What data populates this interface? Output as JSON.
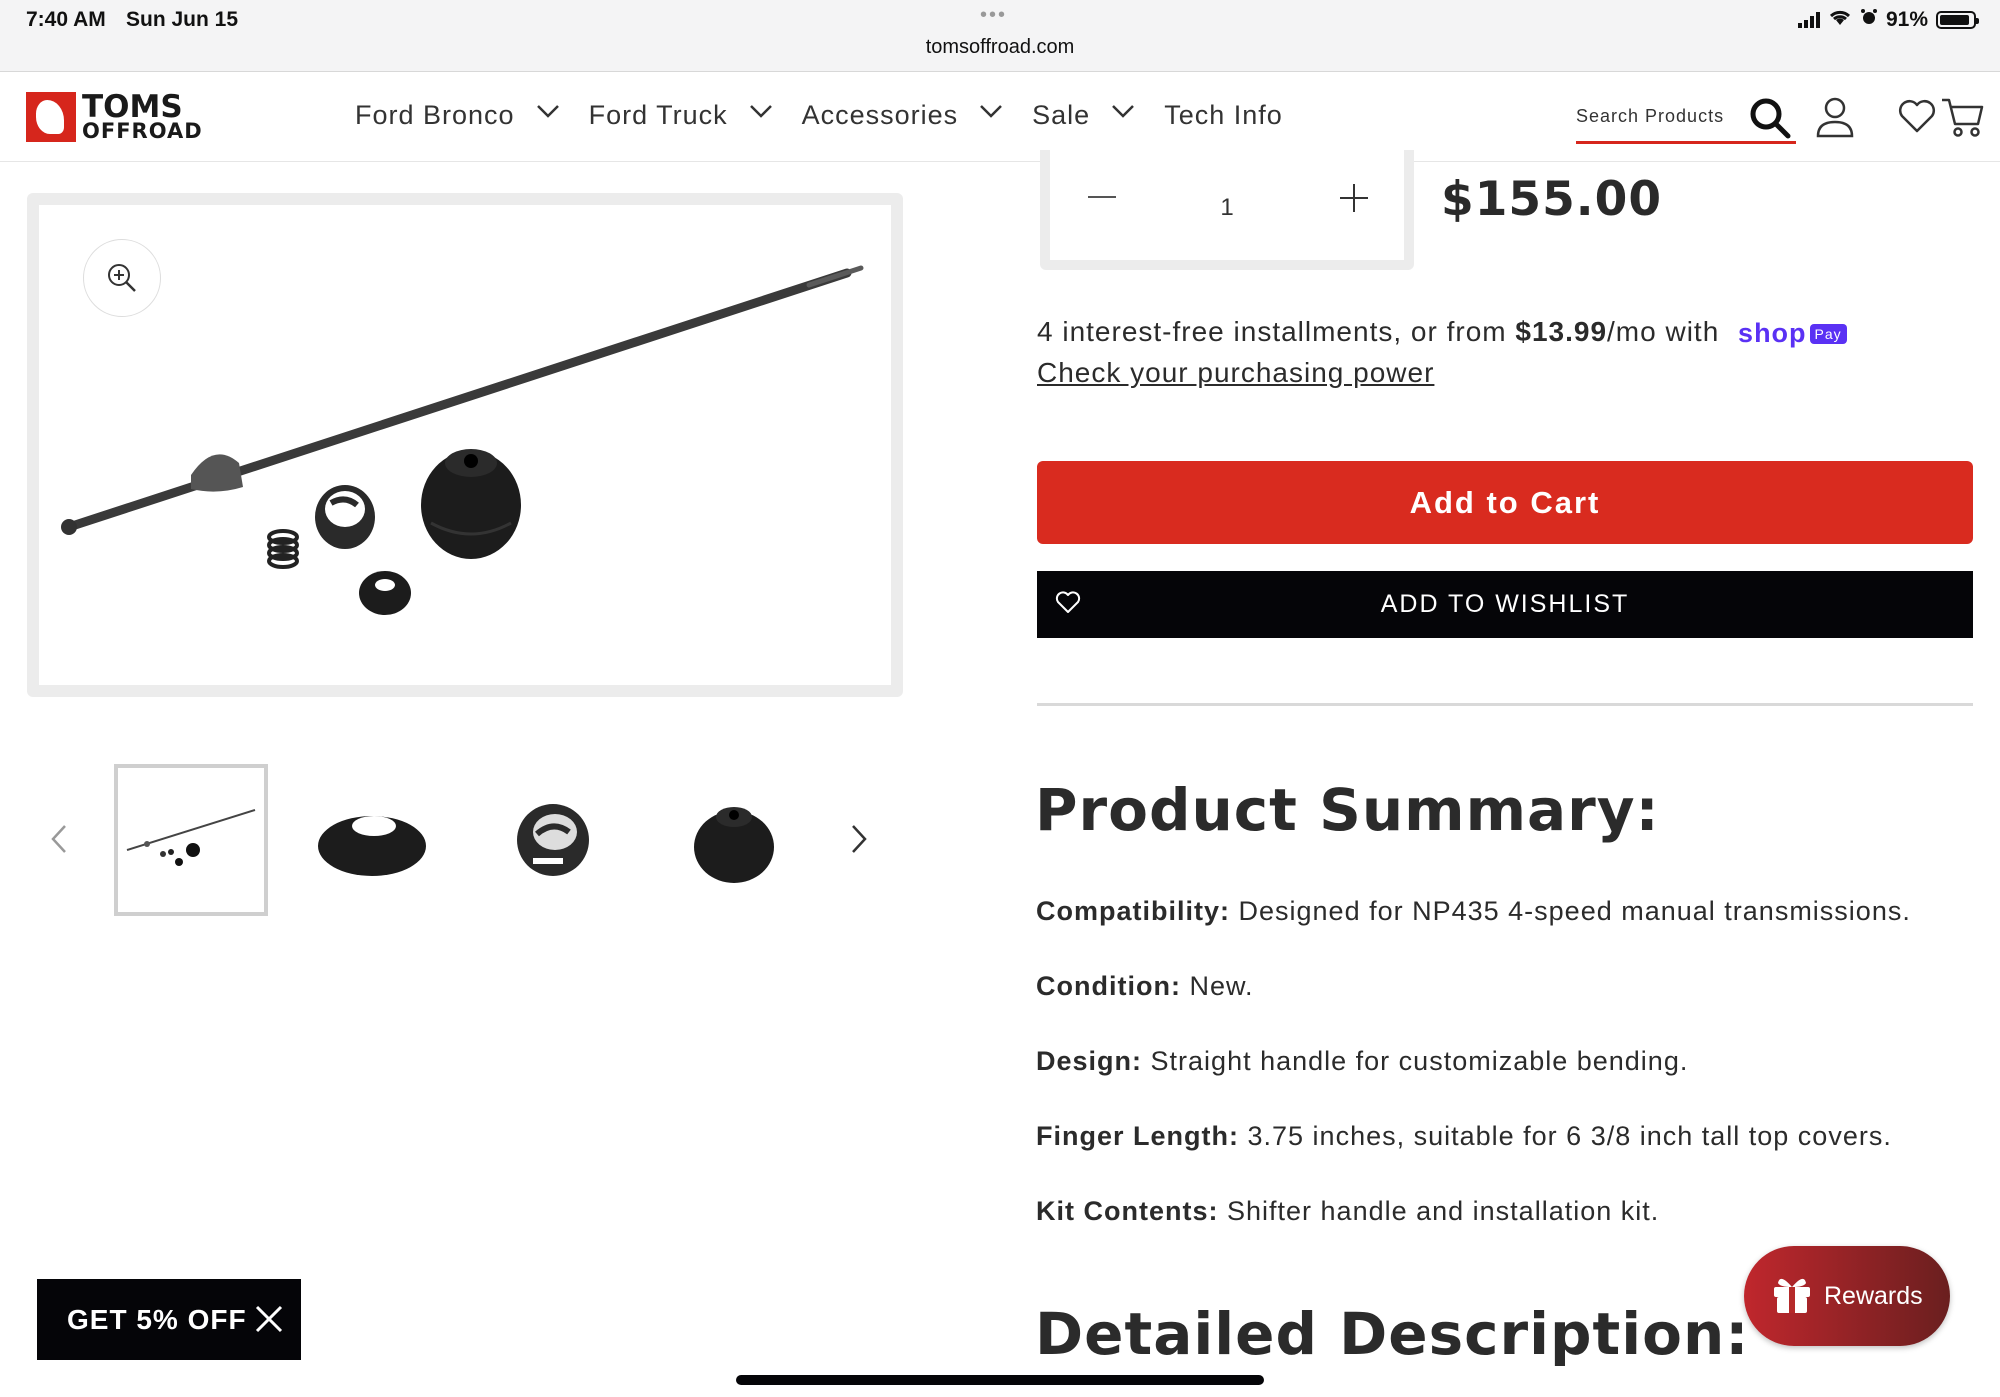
{
  "status_bar": {
    "time": "7:40 AM",
    "date": "Sun Jun 15",
    "url": "tomsoffroad.com",
    "battery": "91%",
    "battery_level": 0.91
  },
  "header": {
    "logo_line1": "TOMS",
    "logo_line2": "OFFROAD",
    "nav": [
      {
        "label": "Ford Bronco",
        "has_dropdown": true
      },
      {
        "label": "Ford Truck",
        "has_dropdown": true
      },
      {
        "label": "Accessories",
        "has_dropdown": true
      },
      {
        "label": "Sale",
        "has_dropdown": true
      },
      {
        "label": "Tech Info",
        "has_dropdown": false
      }
    ],
    "search_placeholder": "Search Products"
  },
  "colors": {
    "brand_red": "#d92b1f",
    "shop_purple": "#5a31f4",
    "black_button": "#050508"
  },
  "product": {
    "quantity": "1",
    "price": "$155.00",
    "installments_text_pre": "4 interest-free installments, or from ",
    "installments_amount": "$13.99",
    "installments_text_post": "/mo with",
    "shop_word": "shop",
    "shop_pay_badge": "Pay",
    "check_power": "Check your purchasing power",
    "add_to_cart": "Add to Cart",
    "add_to_wishlist": "ADD TO WISHLIST"
  },
  "summary": {
    "heading": "Product Summary:",
    "specs": [
      {
        "label": "Compatibility:",
        "value": "Designed for NP435 4-speed manual transmissions."
      },
      {
        "label": "Condition:",
        "value": "New."
      },
      {
        "label": "Design:",
        "value": "Straight handle for customizable bending."
      },
      {
        "label": "Finger Length:",
        "value": "3.75 inches, suitable for 6 3/8 inch tall top covers."
      },
      {
        "label": "Kit Contents:",
        "value": "Shifter handle and installation kit."
      }
    ],
    "detail_heading": "Detailed Description:"
  },
  "promo": {
    "label": "GET 5% OFF"
  },
  "rewards": {
    "label": "Rewards"
  }
}
